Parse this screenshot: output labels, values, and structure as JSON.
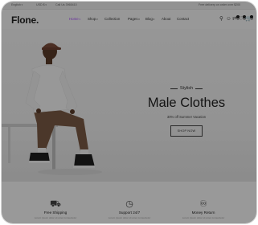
{
  "topbar": {
    "language": "English",
    "currency": "USD $",
    "call": "Call Us 3965410",
    "shipping_note": "Free delivery on order over $200"
  },
  "header": {
    "logo": "Flone.",
    "nav": [
      {
        "label": "Home",
        "active": true,
        "has_dropdown": true
      },
      {
        "label": "Shop",
        "active": false,
        "has_dropdown": true
      },
      {
        "label": "Collection",
        "active": false,
        "has_dropdown": false
      },
      {
        "label": "Pages",
        "active": false,
        "has_dropdown": true
      },
      {
        "label": "Blog",
        "active": false,
        "has_dropdown": true
      },
      {
        "label": "About",
        "active": false,
        "has_dropdown": false
      },
      {
        "label": "Contact",
        "active": false,
        "has_dropdown": false
      }
    ],
    "icons": [
      "search-icon",
      "user-icon",
      "compare-icon",
      "heart-icon",
      "cart-icon"
    ],
    "counts": {
      "compare": "0",
      "wishlist": "0",
      "cart": "0"
    }
  },
  "hero": {
    "kicker": "Stylish",
    "title": "Male Clothes",
    "subtitle": "30% off Summer Vacation",
    "cta": "SHOP NOW"
  },
  "services": [
    {
      "icon": "truck-icon",
      "title": "Free Shipping",
      "desc": "Lorem ipsum dolor sit amet consectetur"
    },
    {
      "icon": "support-icon",
      "title": "Support 24/7",
      "desc": "Lorem ipsum dolor sit amet consectetur"
    },
    {
      "icon": "money-return-icon",
      "title": "Money Return",
      "desc": "Lorem ipsum dolor sit amet consectetur"
    }
  ],
  "colors": {
    "accent": "#a749ff",
    "overlay": "rgba(0,0,0,0.38)"
  }
}
